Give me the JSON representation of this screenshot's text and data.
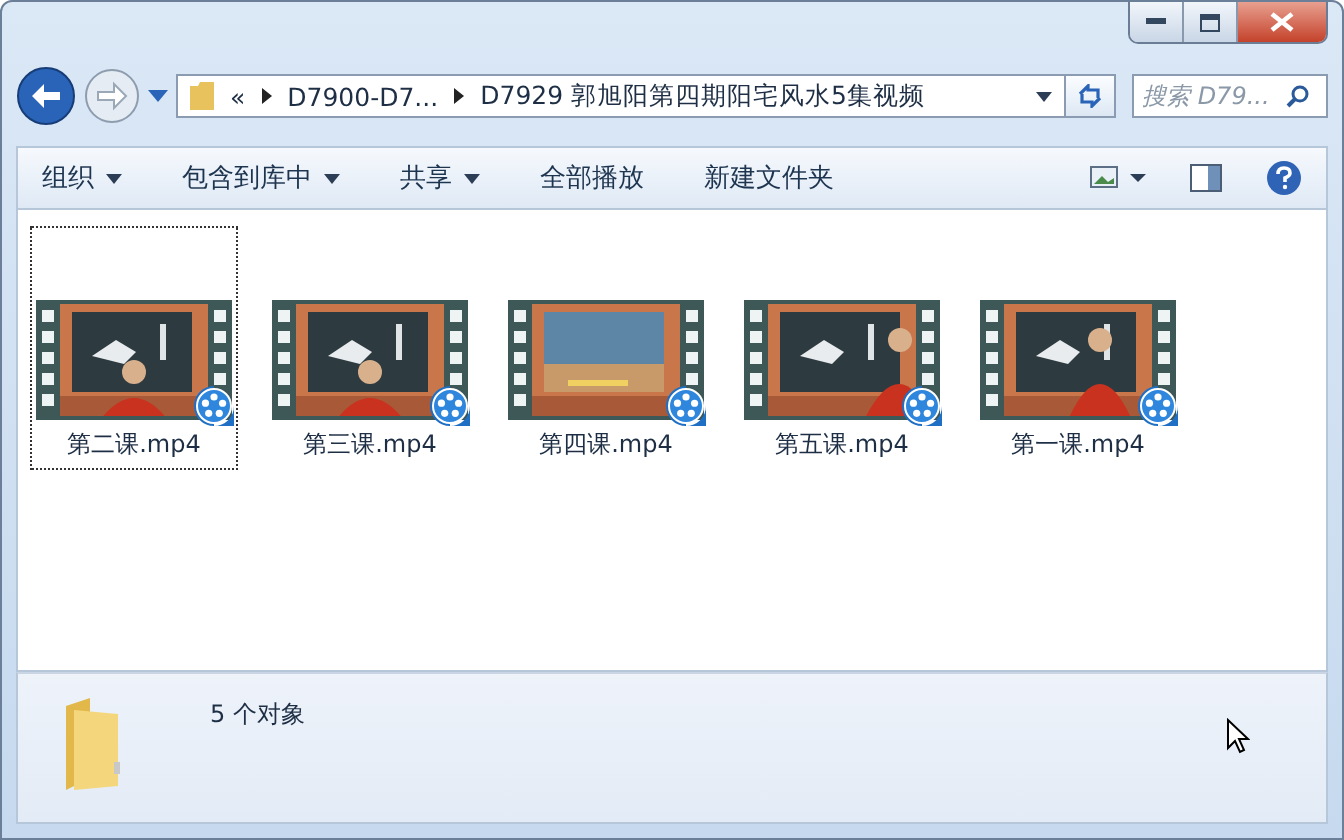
{
  "address": {
    "crumbs": [
      "«",
      "D7900-D7...",
      "D7929 郭旭阳第四期阳宅风水5集视频"
    ]
  },
  "search": {
    "placeholder": "搜索 D79..."
  },
  "toolbar": {
    "items": [
      {
        "label": "组织",
        "dropdown": true
      },
      {
        "label": "包含到库中",
        "dropdown": true
      },
      {
        "label": "共享",
        "dropdown": true
      },
      {
        "label": "全部播放",
        "dropdown": false
      },
      {
        "label": "新建文件夹",
        "dropdown": false
      }
    ]
  },
  "files": [
    {
      "name": "第二课.mp4",
      "focused": true
    },
    {
      "name": "第三课.mp4",
      "focused": false
    },
    {
      "name": "第四课.mp4",
      "focused": false
    },
    {
      "name": "第五课.mp4",
      "focused": false
    },
    {
      "name": "第一课.mp4",
      "focused": false
    }
  ],
  "details": {
    "count": "5 个对象"
  }
}
